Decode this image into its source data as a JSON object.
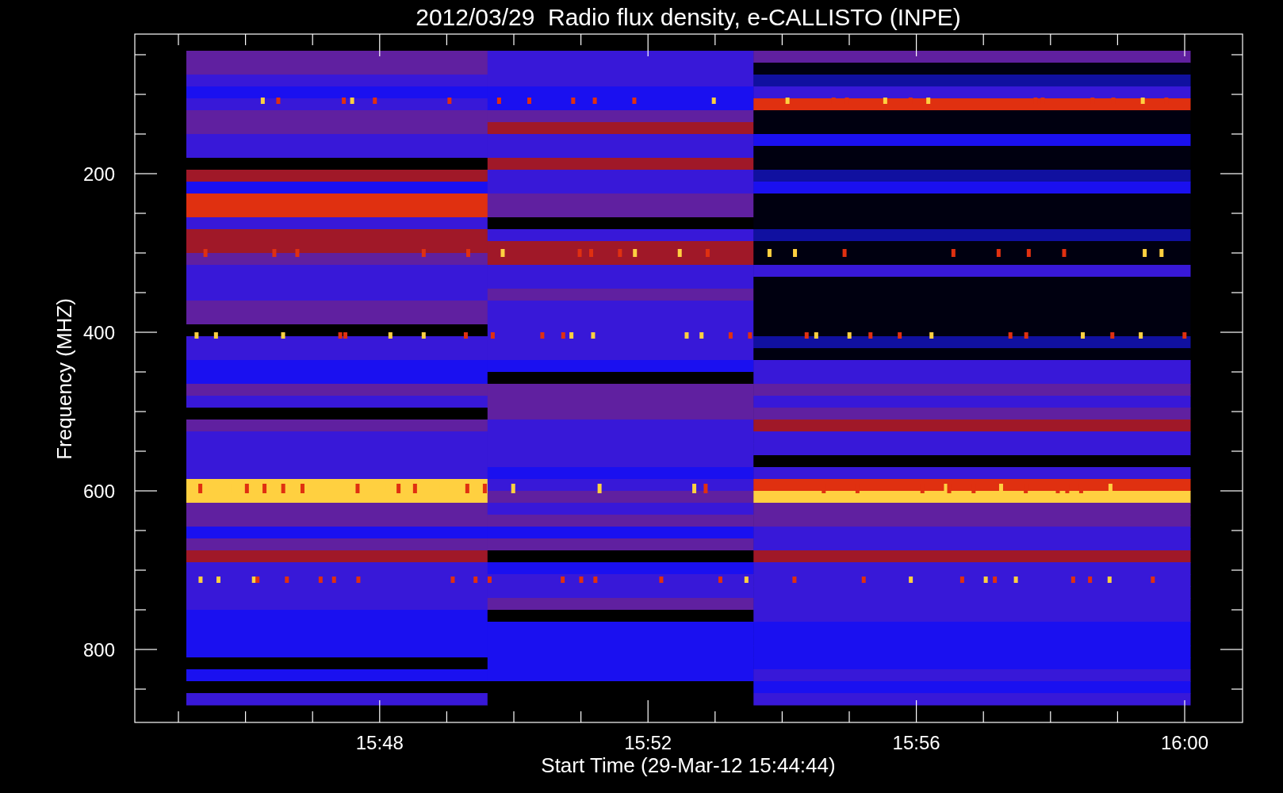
{
  "title": "2012/03/29  Radio flux density, e-CALLISTO (INPE)",
  "xlabel": "Start Time (29-Mar-12 15:44:44)",
  "ylabel": "Frequency (MHZ)",
  "xticks": [
    "15:48",
    "15:52",
    "15:56",
    "16:00"
  ],
  "yticks": [
    "200",
    "400",
    "600",
    "800"
  ]
}
